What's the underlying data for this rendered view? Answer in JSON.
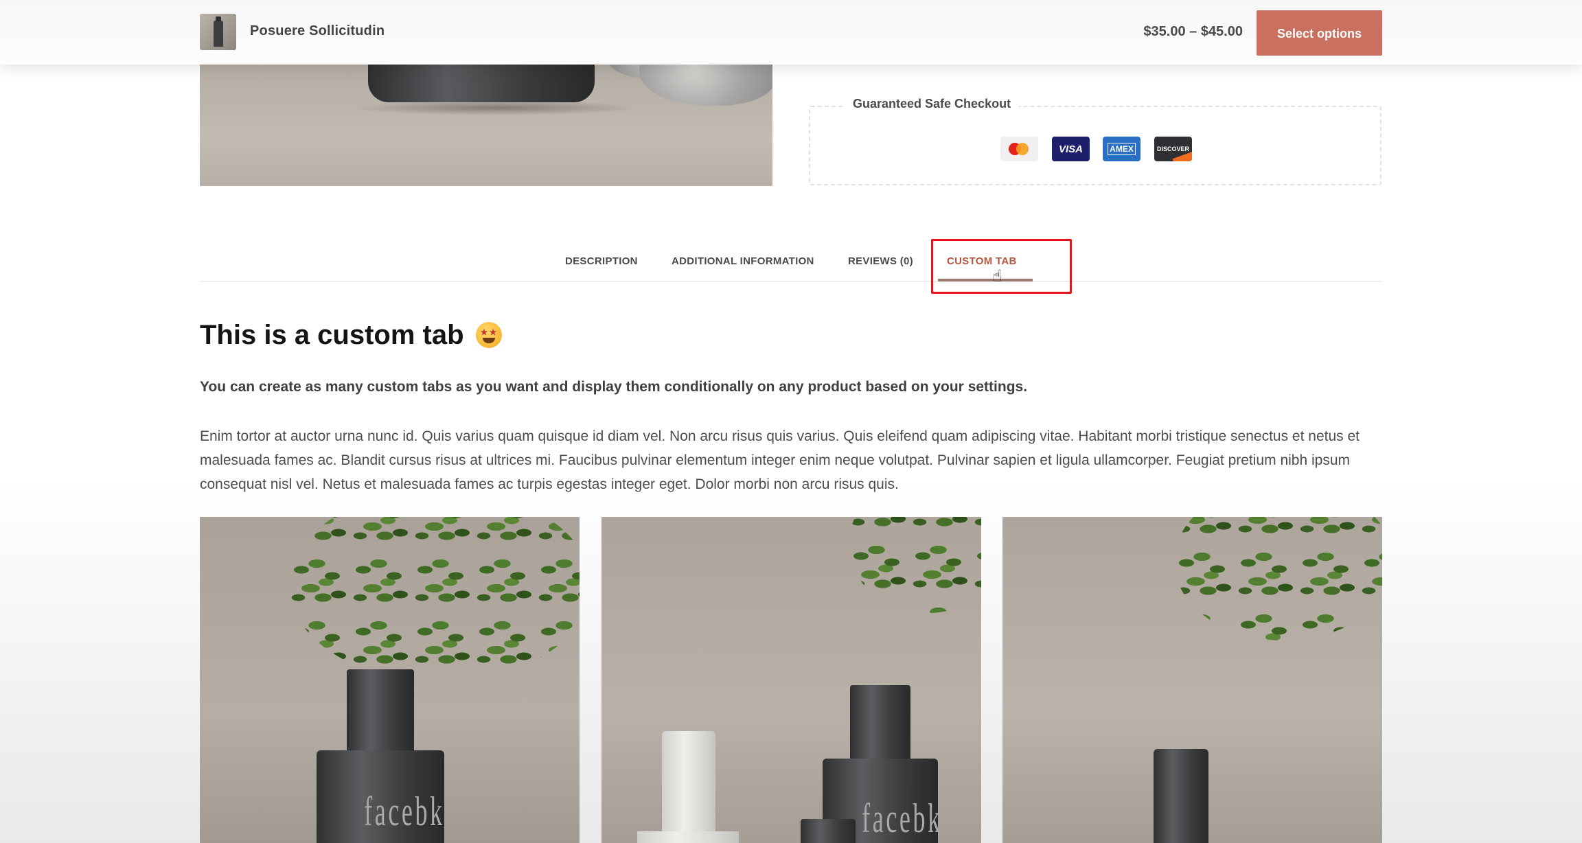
{
  "header": {
    "product_title": "Posuere Sollicitudin",
    "price": "$35.00 – $45.00",
    "button_label": "Select options"
  },
  "checkout": {
    "title": "Guaranteed Safe Checkout",
    "payment_icons": [
      {
        "name": "mastercard-icon",
        "label": ""
      },
      {
        "name": "visa-icon",
        "label": "VISA"
      },
      {
        "name": "amex-icon",
        "label": "AMEX"
      },
      {
        "name": "discover-icon",
        "label": "DISCOVER"
      }
    ]
  },
  "tabs": [
    {
      "label": "DESCRIPTION",
      "active": false
    },
    {
      "label": "ADDITIONAL INFORMATION",
      "active": false
    },
    {
      "label": "REVIEWS (0)",
      "active": false
    },
    {
      "label": "CUSTOM TAB",
      "active": true
    }
  ],
  "content": {
    "heading": "This is a custom tab",
    "heading_emoji": "star-struck-emoji",
    "lead": "You can create as many custom tabs as you want and display them conditionally on any product based on your settings.",
    "body": "Enim tortor at auctor urna nunc id. Quis varius quam quisque id diam vel. Non arcu risus quis varius. Quis eleifend quam adipiscing vitae. Habitant morbi tristique senectus et netus et malesuada fames ac. Blandit cursus risus at ultrices mi. Faucibus pulvinar elementum integer enim neque volutpat. Pulvinar sapien et ligula ullamcorper. Feugiat pretium nibh ipsum consequat nisl vel. Netus et malesuada fames ac turpis egestas integer eget. Dolor morbi non arcu risus quis."
  },
  "gallery": {
    "bottle_brand_text": "facebk"
  },
  "colors": {
    "accent": "#c97060",
    "active_tab": "#b4563e",
    "highlight": "#e4141a"
  }
}
